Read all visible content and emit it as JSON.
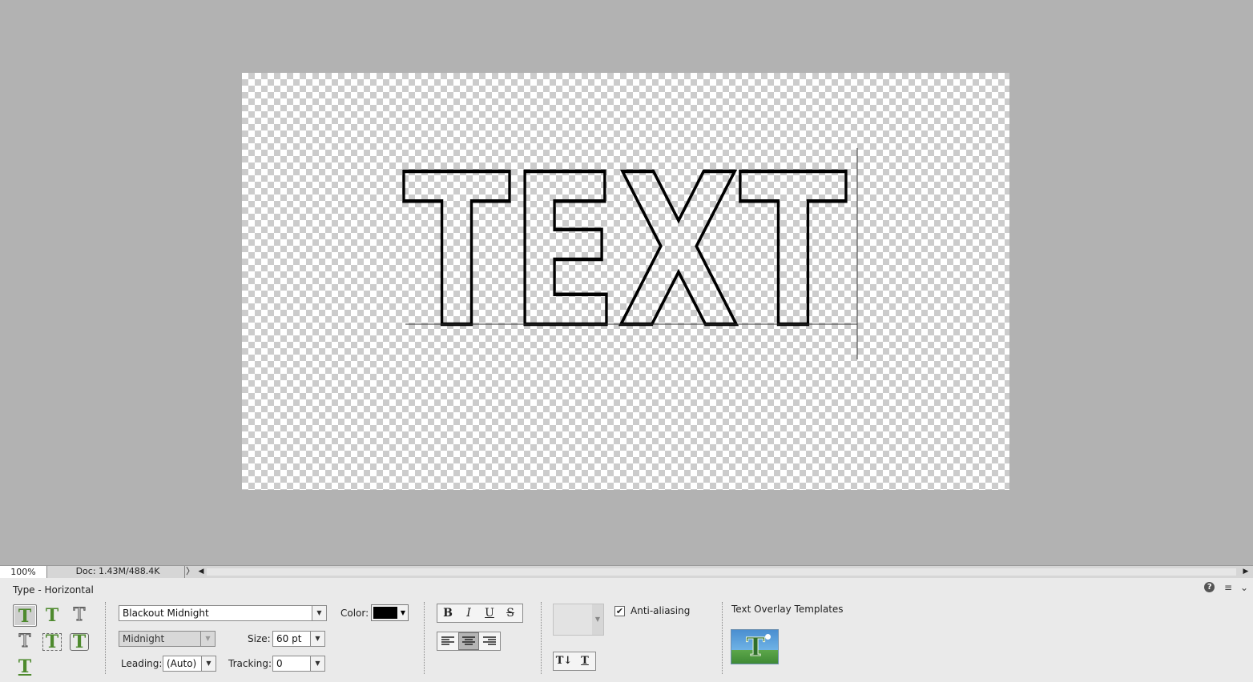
{
  "canvas": {
    "layer_text": "TEXT"
  },
  "status_bar": {
    "zoom": "100%",
    "doc_info": "Doc: 1.43M/488.4K",
    "doc_arrow": "〉",
    "scroll_left": "◀",
    "scroll_right": "▶"
  },
  "tool_options": {
    "tool_name": "Type - Horizontal",
    "type_tools": [
      {
        "name": "horizontal-type",
        "glyph": "T"
      },
      {
        "name": "vertical-type",
        "glyph": "T"
      },
      {
        "name": "horizontal-type-mask",
        "glyph": "T"
      },
      {
        "name": "vertical-type-mask",
        "glyph": "T"
      },
      {
        "name": "text-on-selection",
        "glyph": "T"
      },
      {
        "name": "text-on-shape",
        "glyph": "T"
      },
      {
        "name": "text-on-path",
        "glyph": "T"
      }
    ],
    "font_family": "Blackout Midnight",
    "font_style": "Midnight",
    "size_label": "Size:",
    "size_value": "60 pt",
    "leading_label": "Leading:",
    "leading_value": "(Auto)",
    "tracking_label": "Tracking:",
    "tracking_value": "0",
    "color_label": "Color:",
    "color_value": "#000000",
    "format_buttons": {
      "bold": "B",
      "italic": "I",
      "underline": "U",
      "strikethrough": "S"
    },
    "anti_aliasing_label": "Anti-aliasing",
    "anti_aliasing_checked": true,
    "check_mark": "✔",
    "orientation_buttons": {
      "toggle": "T↓",
      "warp": "T"
    },
    "text_overlay_label": "Text Overlay Templates",
    "text_overlay_thumb_glyph": "T",
    "help_glyph": "?",
    "panel_menu_glyph": "≡",
    "collapse_glyph": "⌄"
  }
}
